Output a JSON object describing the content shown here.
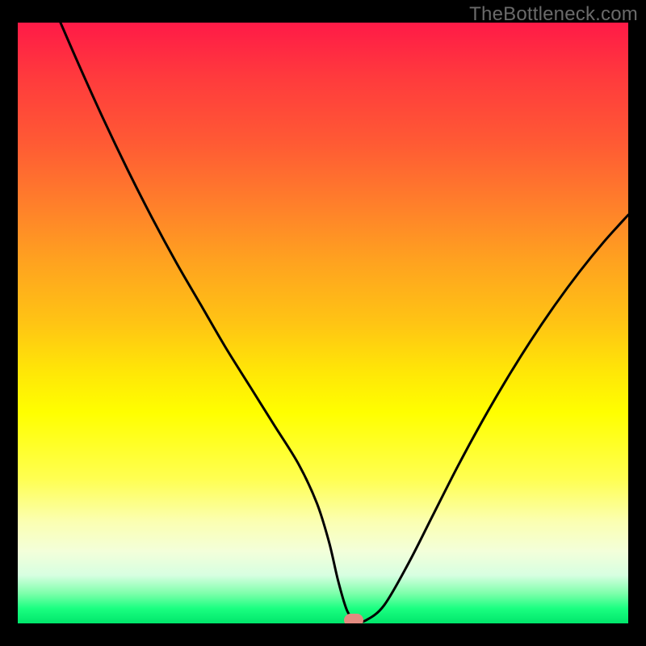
{
  "watermark": "TheBottleneck.com",
  "colors": {
    "page_bg": "#000000",
    "watermark": "#6a6a6a",
    "curve": "#000000",
    "marker_fill": "#e38b80",
    "gradient_top": "#ff1a47",
    "gradient_bottom": "#00e66b"
  },
  "chart_data": {
    "type": "line",
    "title": "",
    "xlabel": "",
    "ylabel": "",
    "xlim": [
      0,
      100
    ],
    "ylim": [
      0,
      100
    ],
    "grid": false,
    "legend": false,
    "series": [
      {
        "name": "bottleneck-curve",
        "x": [
          7,
          10,
          14,
          18,
          22,
          26,
          30,
          34,
          38,
          42,
          46,
          49,
          51,
          52.5,
          54,
          55.5,
          57,
          60,
          64,
          68,
          72,
          76,
          80,
          84,
          88,
          92,
          96,
          100
        ],
        "y": [
          100,
          93,
          84,
          75.5,
          67.5,
          60,
          53,
          46,
          39.5,
          33,
          26.5,
          20,
          13.5,
          7,
          2,
          0.5,
          0.5,
          3,
          10,
          18,
          26,
          33.5,
          40.5,
          47,
          53,
          58.5,
          63.5,
          68
        ]
      }
    ],
    "marker": {
      "x": 55,
      "y": 0.5
    },
    "annotations": []
  }
}
